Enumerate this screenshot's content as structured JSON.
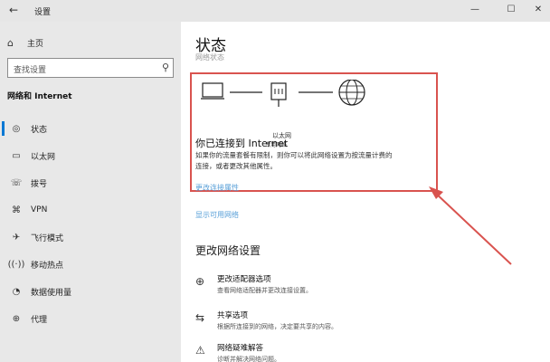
{
  "window": {
    "title": "设置",
    "back_icon": "←",
    "min": "—",
    "max": "☐",
    "close": "✕"
  },
  "sidebar": {
    "home": "主页",
    "search_placeholder": "查找设置",
    "section": "网络和 Internet",
    "items": [
      {
        "label": "状态",
        "icon": "globe-icon"
      },
      {
        "label": "以太网",
        "icon": "ethernet-icon"
      },
      {
        "label": "拨号",
        "icon": "dialup-icon"
      },
      {
        "label": "VPN",
        "icon": "vpn-icon"
      },
      {
        "label": "飞行模式",
        "icon": "airplane-icon"
      },
      {
        "label": "移动热点",
        "icon": "hotspot-icon"
      },
      {
        "label": "数据使用量",
        "icon": "data-usage-icon"
      },
      {
        "label": "代理",
        "icon": "proxy-icon"
      }
    ]
  },
  "main": {
    "title": "状态",
    "subtitle_faded": "网络状态",
    "connection": {
      "label": "以太网",
      "sublabel": "专用网络"
    },
    "status_heading": "你已连接到 Internet",
    "status_desc_line1": "如果你的流量套餐有限制，则你可以将此网络设置为按流量计费的",
    "status_desc_line2": "连接，或者更改其他属性。",
    "link_change_props": "更改连接属性",
    "link_show_networks": "显示可用网络",
    "change_heading": "更改网络设置",
    "options": [
      {
        "title": "更改适配器选项",
        "desc": "查看网络适配器并更改连接设置。",
        "icon": "adapter-icon"
      },
      {
        "title": "共享选项",
        "desc": "根据所连接到的网络，决定要共享的内容。",
        "icon": "share-icon"
      },
      {
        "title": "网络疑难解答",
        "desc": "诊断并解决网络问题。",
        "icon": "warning-icon"
      }
    ]
  },
  "colors": {
    "accent": "#0078d4",
    "highlight": "#d9534f",
    "link": "#5aa0d8"
  }
}
